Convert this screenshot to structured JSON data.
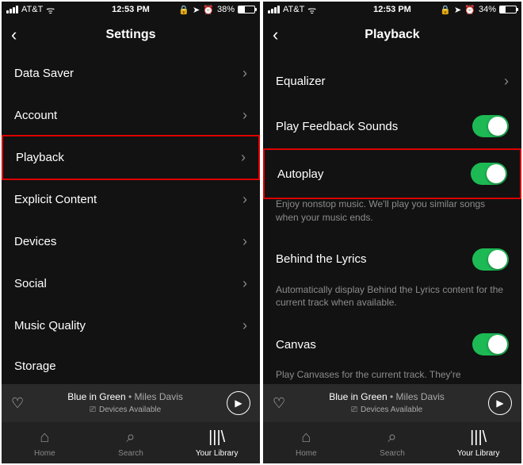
{
  "left": {
    "status": {
      "carrier": "AT&T",
      "time": "12:53 PM",
      "battery_pct": "38%",
      "battery_fill": 38
    },
    "title": "Settings",
    "items": [
      {
        "label": "Data Saver"
      },
      {
        "label": "Account"
      },
      {
        "label": "Playback",
        "highlight": true
      },
      {
        "label": "Explicit Content"
      },
      {
        "label": "Devices"
      },
      {
        "label": "Social"
      },
      {
        "label": "Music Quality"
      },
      {
        "label": "Storage",
        "cut": true
      }
    ],
    "nowplaying": {
      "track": "Blue in Green",
      "artist": "Miles Davis",
      "devices": "Devices Available"
    },
    "tabs": {
      "home": "Home",
      "search": "Search",
      "library": "Your Library"
    }
  },
  "right": {
    "status": {
      "carrier": "AT&T",
      "time": "12:53 PM",
      "battery_pct": "34%",
      "battery_fill": 34
    },
    "title": "Playback",
    "items": [
      {
        "label": "Equalizer",
        "type": "chevron"
      },
      {
        "label": "Play Feedback Sounds",
        "type": "toggle",
        "on": true
      },
      {
        "label": "Autoplay",
        "type": "toggle",
        "on": true,
        "highlight": true,
        "desc": "Enjoy nonstop music. We'll play you similar songs when your music ends."
      },
      {
        "label": "Behind the Lyrics",
        "type": "toggle",
        "on": true,
        "desc": "Automatically display Behind the Lyrics content for the current track when available."
      },
      {
        "label": "Canvas",
        "type": "toggle",
        "on": true,
        "desc": "Play Canvases for the current track. They're"
      }
    ],
    "nowplaying": {
      "track": "Blue in Green",
      "artist": "Miles Davis",
      "devices": "Devices Available"
    },
    "tabs": {
      "home": "Home",
      "search": "Search",
      "library": "Your Library"
    }
  },
  "icons": {
    "lock": "🔒",
    "alarm": "⏰",
    "location": "➤"
  }
}
